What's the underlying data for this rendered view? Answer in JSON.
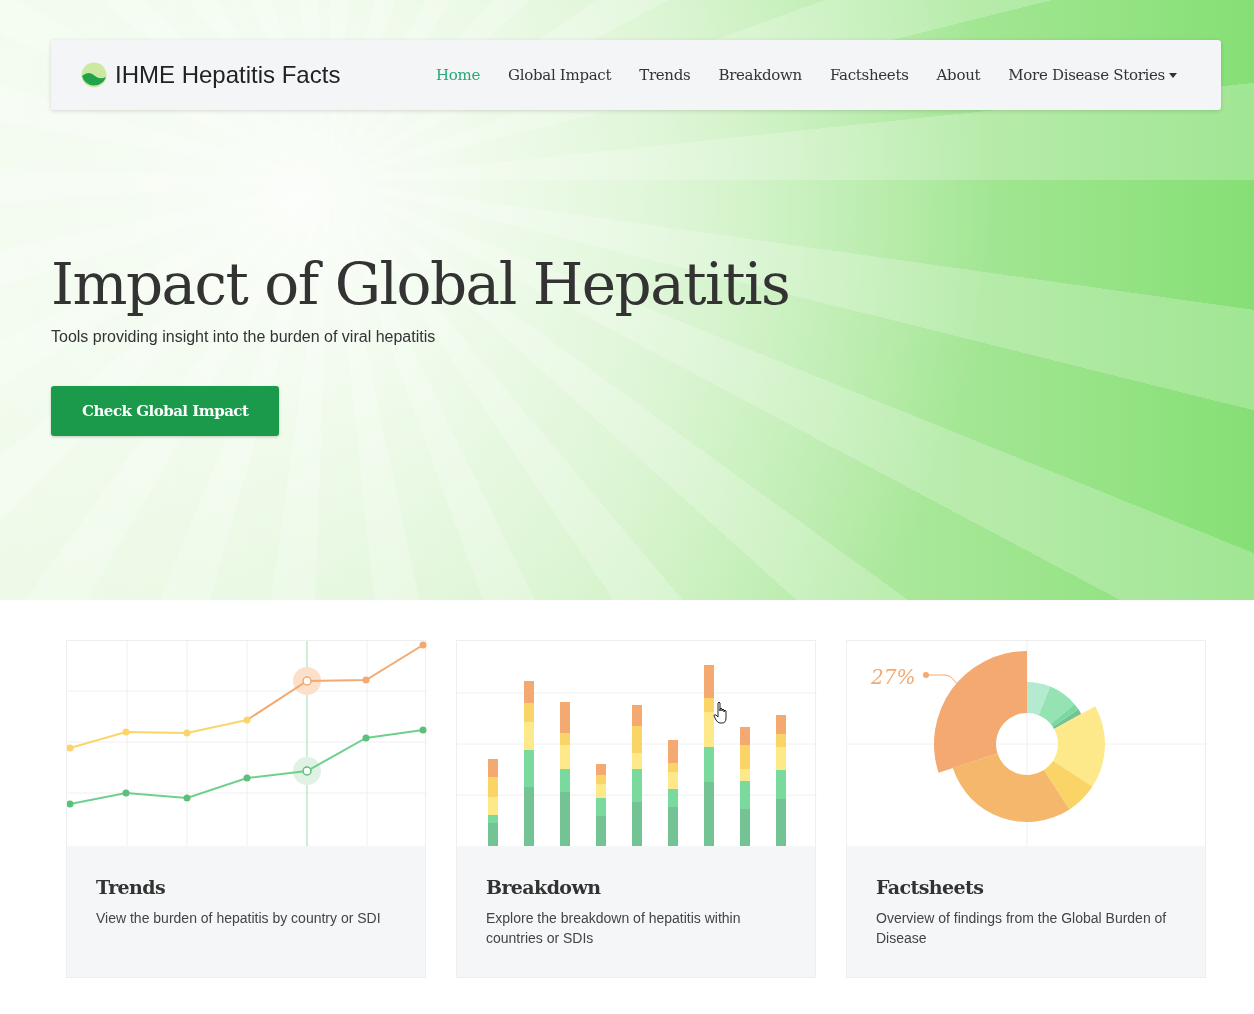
{
  "navbar": {
    "brand": "IHME Hepatitis Facts",
    "links": [
      {
        "label": "Home",
        "selected": true,
        "kind": "link"
      },
      {
        "label": "Global Impact",
        "selected": false,
        "kind": "link"
      },
      {
        "label": "Trends",
        "selected": false,
        "kind": "link"
      },
      {
        "label": "Breakdown",
        "selected": false,
        "kind": "link"
      },
      {
        "label": "Factsheets",
        "selected": false,
        "kind": "link"
      },
      {
        "label": "About",
        "selected": false,
        "kind": "link"
      },
      {
        "label": "More Disease Stories",
        "selected": false,
        "kind": "dropdown"
      }
    ]
  },
  "hero": {
    "title": "Impact of Global Hepatitis",
    "subtitle": "Tools providing insight into the burden of viral hepatitis",
    "button": "Check Global Impact"
  },
  "cards": [
    {
      "kind": "line",
      "title": "Trends",
      "description": "View the burden of hepatitis by country or SDI"
    },
    {
      "kind": "bar",
      "title": "Breakdown",
      "description": "Explore the breakdown of hepatitis within countries or SDIs"
    },
    {
      "kind": "donut",
      "callout": "27%",
      "title": "Factsheets",
      "description": "Overview of findings from the Global Burden of Disease"
    }
  ]
}
